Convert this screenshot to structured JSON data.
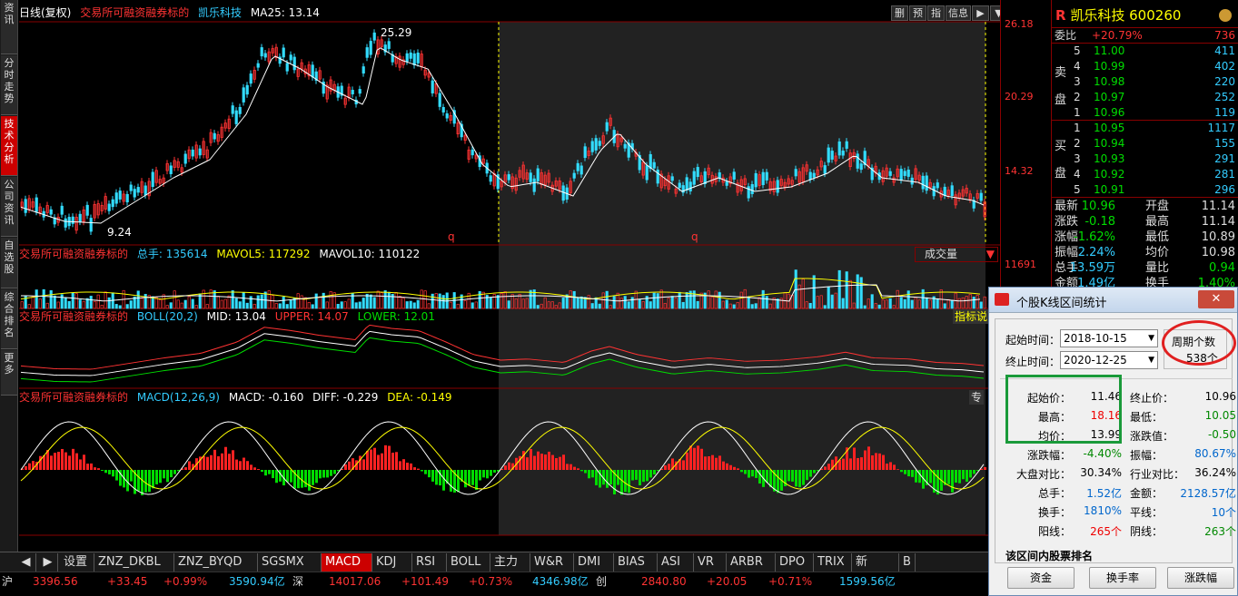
{
  "left_tabs": [
    "资讯",
    "分时走势",
    "技术分析",
    "公司资讯",
    "自选股",
    "综合排名",
    "更多"
  ],
  "main_title": {
    "period": "日线(复权)",
    "flag": "交易所可融资融券标的",
    "stock": "凯乐科技",
    "ma": "MA25: 13.14"
  },
  "toolbar": {
    "b1": "删",
    "b2": "预",
    "b3": "指",
    "b4": "信息",
    "b5": "▶",
    "b6": "▼"
  },
  "price_marks": {
    "high": "25.29",
    "low": "9.24"
  },
  "axis_labels": {
    "p1": "26.18",
    "p2": "20.29",
    "p3": "14.32",
    "v1": "11691"
  },
  "vol_title": {
    "flag": "交易所可融资融券标的",
    "total": "总手: 135614",
    "ma5": "MAVOL5: 117292",
    "ma10": "MAVOL10: 110122",
    "select": "成交量"
  },
  "boll_title": {
    "flag": "交易所可融资融券标的",
    "name": "BOLL(20,2)",
    "mid": "MID: 13.04",
    "upper": "UPPER: 14.07",
    "lower": "LOWER: 12.01",
    "btn": "指标说"
  },
  "macd_title": {
    "flag": "交易所可融资融券标的",
    "name": "MACD(12,26,9)",
    "macd": "MACD: -0.160",
    "diff": "DIFF: -0.229",
    "dea": "DEA: -0.149",
    "btn": "专"
  },
  "q_markers": [
    "q",
    "q"
  ],
  "bottom_tabs": [
    "设置",
    "ZNZ_DKBL",
    "ZNZ_BYQD",
    "SGSMX",
    "MACD",
    "KDJ",
    "RSI",
    "BOLL",
    "主力",
    "W&R",
    "DMI",
    "BIAS",
    "ASI",
    "VR",
    "ARBR",
    "DPO",
    "TRIX",
    "新DMA",
    "B"
  ],
  "quote": {
    "logo": "R",
    "name": "凯乐科技",
    "code": "600260",
    "weibi_label": "委比",
    "weibi": "+20.79%",
    "weicha": "736",
    "sell_label": [
      "卖",
      "盘"
    ],
    "buy_label": [
      "买",
      "盘"
    ],
    "sell": [
      {
        "n": "5",
        "p": "11.00",
        "v": "411"
      },
      {
        "n": "4",
        "p": "10.99",
        "v": "402"
      },
      {
        "n": "3",
        "p": "10.98",
        "v": "220"
      },
      {
        "n": "2",
        "p": "10.97",
        "v": "252"
      },
      {
        "n": "1",
        "p": "10.96",
        "v": "119"
      }
    ],
    "buy": [
      {
        "n": "1",
        "p": "10.95",
        "v": "1117"
      },
      {
        "n": "2",
        "p": "10.94",
        "v": "155"
      },
      {
        "n": "3",
        "p": "10.93",
        "v": "291"
      },
      {
        "n": "4",
        "p": "10.92",
        "v": "281"
      },
      {
        "n": "5",
        "p": "10.91",
        "v": "296"
      }
    ],
    "stats": [
      {
        "l1": "最新",
        "v1": "10.96",
        "l2": "开盘",
        "v2": "11.14"
      },
      {
        "l1": "涨跌",
        "v1": "-0.18",
        "l2": "最高",
        "v2": "11.14"
      },
      {
        "l1": "涨幅",
        "v1": "-1.62%",
        "l2": "最低",
        "v2": "10.89"
      },
      {
        "l1": "振幅",
        "v1": "2.24%",
        "l2": "均价",
        "v2": "10.98"
      },
      {
        "l1": "总手",
        "v1": "13.59万",
        "l2": "量比",
        "v2": "0.94"
      },
      {
        "l1": "金额",
        "v1": "1.49亿",
        "l2": "换手",
        "v2": "1.40%"
      }
    ]
  },
  "dialog": {
    "title": "个股K线区间统计",
    "close": "✕",
    "start_label": "起始时间：",
    "start_value": "2018-10-15",
    "end_label": "终止时间：",
    "end_value": "2020-12-25",
    "period_label": "周期个数",
    "period_value": "538个",
    "rows": [
      {
        "l1": "起始价：",
        "v1": "11.46",
        "l2": "终止价：",
        "v2": "10.96"
      },
      {
        "l1": "最高：",
        "v1": "18.16",
        "l2": "最低：",
        "v2": "10.05"
      },
      {
        "l1": "均价：",
        "v1": "13.99",
        "l2": "涨跌值：",
        "v2": "-0.50"
      },
      {
        "l1": "涨跌幅：",
        "v1": "-4.40%",
        "l2": "振幅：",
        "v2": "80.67%"
      },
      {
        "l1": "大盘对比：",
        "v1": "30.34%",
        "l2": "行业对比：",
        "v2": "36.24%"
      },
      {
        "l1": "总手：",
        "v1": "1.52亿",
        "l2": "金额：",
        "v2": "2128.57亿"
      },
      {
        "l1": "换手：",
        "v1": "1810%",
        "l2": "平线：",
        "v2": "10个"
      },
      {
        "l1": "阳线：",
        "v1": "265个",
        "l2": "阴线：",
        "v2": "263个"
      }
    ],
    "section": "该区间内股票排名",
    "buttons": [
      "资金",
      "换手率",
      "涨跌幅"
    ]
  },
  "status": {
    "sh_label": "沪",
    "sh_idx": "3396.56",
    "sh_chg": "+33.45",
    "sh_pct": "+0.99%",
    "sh_amt": "3590.94亿",
    "sz_label": "深",
    "sz_idx": "14017.06",
    "sz_chg": "+101.49",
    "sz_pct": "+0.73%",
    "sz_amt": "4346.98亿",
    "cy_label": "创",
    "cy_idx": "2840.80",
    "cy_chg": "+20.05",
    "cy_pct": "+0.71%",
    "cy_amt": "1599.56亿"
  },
  "colors": {
    "up": "#ff3333",
    "down": "#33ddff",
    "macd_up": "#ff2222",
    "macd_down": "#00dd00",
    "accent": "#cc0000"
  }
}
